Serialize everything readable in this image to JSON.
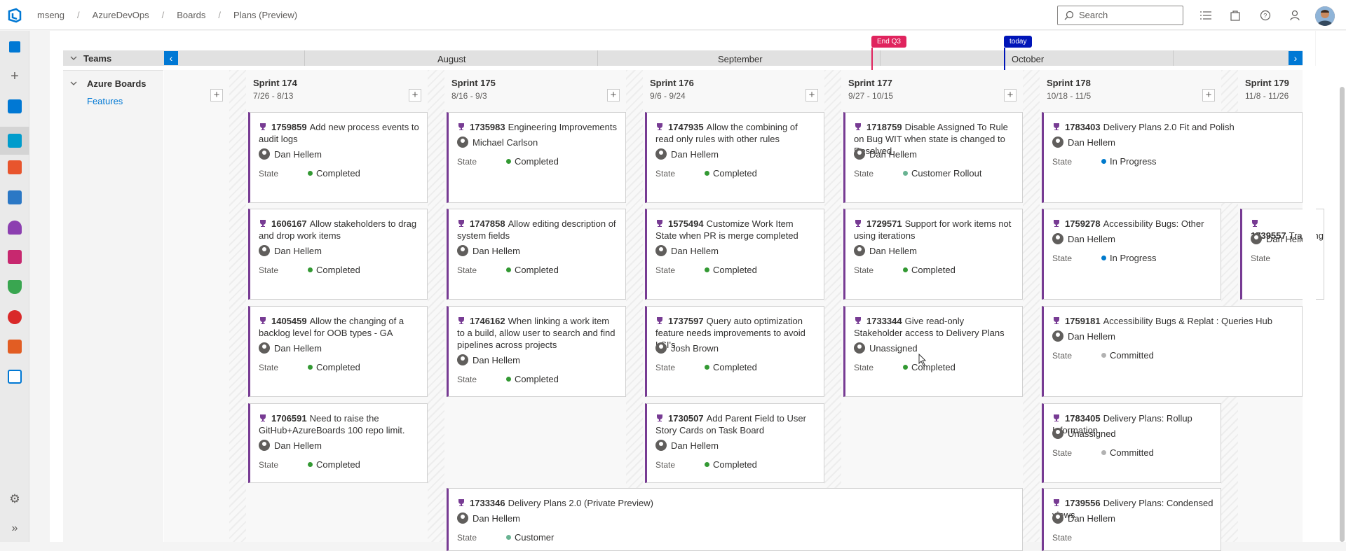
{
  "breadcrumb": [
    "mseng",
    "AzureDevOps",
    "Boards",
    "Plans (Preview)"
  ],
  "search": {
    "placeholder": "Search"
  },
  "icons": {
    "logo": "azure-devops-logo",
    "top": [
      "list-icon",
      "shopping-bag-icon",
      "help-icon",
      "user-settings-icon"
    ],
    "rail": [
      "overview-icon",
      "add-icon",
      "dashboard-icon",
      "boards-icon",
      "repos-icon",
      "pipelines-icon",
      "test-plans-icon",
      "artifacts-icon",
      "security-icon",
      "release-icon",
      "analytics-icon",
      "flow-icon",
      "settings-icon",
      "expand-icon"
    ]
  },
  "timeline": {
    "teams_label": "Teams",
    "months": [
      "August",
      "September",
      "October"
    ],
    "markers": [
      {
        "label": "End Q3",
        "color": "#e0245e"
      },
      {
        "label": "today",
        "color": "#0015b8"
      }
    ]
  },
  "team": {
    "name": "Azure Boards",
    "backlog": "Features"
  },
  "sprints": [
    {
      "name": "Sprint 174",
      "dates": "7/26 - 8/13"
    },
    {
      "name": "Sprint 175",
      "dates": "8/16 - 9/3"
    },
    {
      "name": "Sprint 176",
      "dates": "9/6 - 9/24"
    },
    {
      "name": "Sprint 177",
      "dates": "9/27 - 10/15"
    },
    {
      "name": "Sprint 178",
      "dates": "10/18 - 11/5"
    },
    {
      "name": "Sprint 179",
      "dates": "11/8 - 11/26"
    }
  ],
  "state_label": "State",
  "state_colors": {
    "Completed": "#339933",
    "In Progress": "#007acc",
    "Committed": "#b2b2b2",
    "Customer Rollout": "#69b392",
    "Customer": "#69b392"
  },
  "cards": [
    {
      "id": "1759859",
      "title": "Add new process events to audit logs",
      "assignee": "Dan Hellem",
      "state": "Completed"
    },
    {
      "id": "1606167",
      "title": "Allow stakeholders to drag and drop work items",
      "assignee": "Dan Hellem",
      "state": "Completed"
    },
    {
      "id": "1405459",
      "title": "Allow the changing of a backlog level for OOB types - GA",
      "assignee": "Dan Hellem",
      "state": "Completed"
    },
    {
      "id": "1706591",
      "title": "Need to raise the GitHub+AzureBoards 100 repo limit.",
      "assignee": "Dan Hellem",
      "state": "Completed"
    },
    {
      "id": "1735983",
      "title": "Engineering Improvements",
      "assignee": "Michael Carlson",
      "state": "Completed"
    },
    {
      "id": "1747858",
      "title": "Allow editing description of system fields",
      "assignee": "Dan Hellem",
      "state": "Completed"
    },
    {
      "id": "1746162",
      "title": "When linking a work item to a build, allow user to search and find pipelines across projects",
      "assignee": "Dan Hellem",
      "state": "Completed"
    },
    {
      "id": "1747935",
      "title": "Allow the combining of read only rules with other rules",
      "assignee": "Dan Hellem",
      "state": "Completed"
    },
    {
      "id": "1575494",
      "title": "Customize Work Item State when PR is merge completed",
      "assignee": "Dan Hellem",
      "state": "Completed"
    },
    {
      "id": "1737597",
      "title": "Query auto optimization feature needs improvements to avoid LSI's",
      "assignee": "Josh Brown",
      "state": "Completed"
    },
    {
      "id": "1730507",
      "title": "Add Parent Field to User Story Cards on Task Board",
      "assignee": "Dan Hellem",
      "state": "Completed"
    },
    {
      "id": "1718759",
      "title": "Disable Assigned To Rule on Bug WIT when state is changed to Resolved",
      "assignee": "Dan Hellem",
      "state": "Customer Rollout"
    },
    {
      "id": "1729571",
      "title": "Support for work items not using iterations",
      "assignee": "Dan Hellem",
      "state": "Completed"
    },
    {
      "id": "1733344",
      "title": "Give read-only Stakeholder access to Delivery Plans",
      "assignee": "Unassigned",
      "state": "Completed"
    },
    {
      "id": "1783403",
      "title": "Delivery Plans 2.0 Fit and Polish",
      "assignee": "Dan Hellem",
      "state": "In Progress"
    },
    {
      "id": "1759278",
      "title": "Accessibility Bugs: Other",
      "assignee": "Dan Hellem",
      "state": "In Progress"
    },
    {
      "id": "1759181",
      "title": "Accessibility Bugs & Replat : Queries Hub",
      "assignee": "Dan Hellem",
      "state": "Committed"
    },
    {
      "id": "1783405",
      "title": "Delivery Plans: Rollup Information",
      "assignee": "Unassigned",
      "state": "Committed"
    },
    {
      "id": "1739556",
      "title": "Delivery Plans: Condensed views",
      "assignee": "Dan Hellem",
      "state": ""
    },
    {
      "id": "1739557",
      "title": "Tracking",
      "assignee": "Dan Helle",
      "state": ""
    },
    {
      "id": "1733346",
      "title": "Delivery Plans 2.0 (Private Preview)",
      "assignee": "Dan Hellem",
      "state": "Customer"
    }
  ]
}
